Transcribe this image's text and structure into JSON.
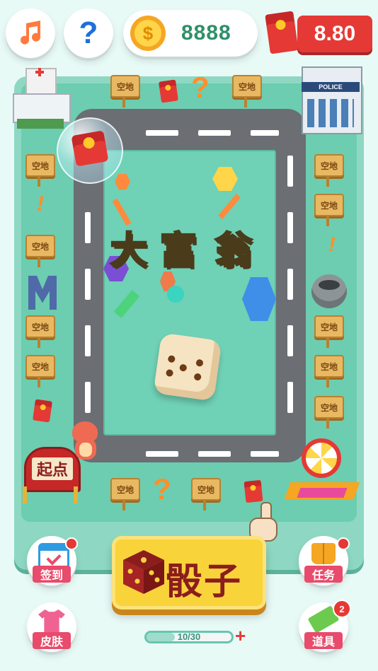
{
  "top_bar": {
    "music_icon": "music-note-icon",
    "help_icon": "question-mark-icon",
    "coin_icon": "gold-coin-icon",
    "coin_value": "8888",
    "red_packet_icon": "red-envelope-icon",
    "money_value": "8.80"
  },
  "board": {
    "title": "大富翁",
    "title_chars": [
      "大",
      "富",
      "翁"
    ],
    "start_label": "起点",
    "tile_label": "空地",
    "hospital_icon": "hospital-building-icon",
    "police_label": "POLICE",
    "bubble_icon": "red-envelope-bubble-icon"
  },
  "actions": {
    "dice_label": "骰子",
    "signin_label": "签到",
    "task_label": "任务",
    "skin_label": "皮肤",
    "items_label": "道具",
    "items_badge": "2",
    "progress_text": "10/30",
    "progress_fraction": 0.333,
    "progress_plus": "+"
  },
  "colors": {
    "accent_green": "#6ccdb0",
    "dice_yellow": "#f9d33a",
    "red": "#e53935",
    "coin_text": "#2f8f6a"
  }
}
